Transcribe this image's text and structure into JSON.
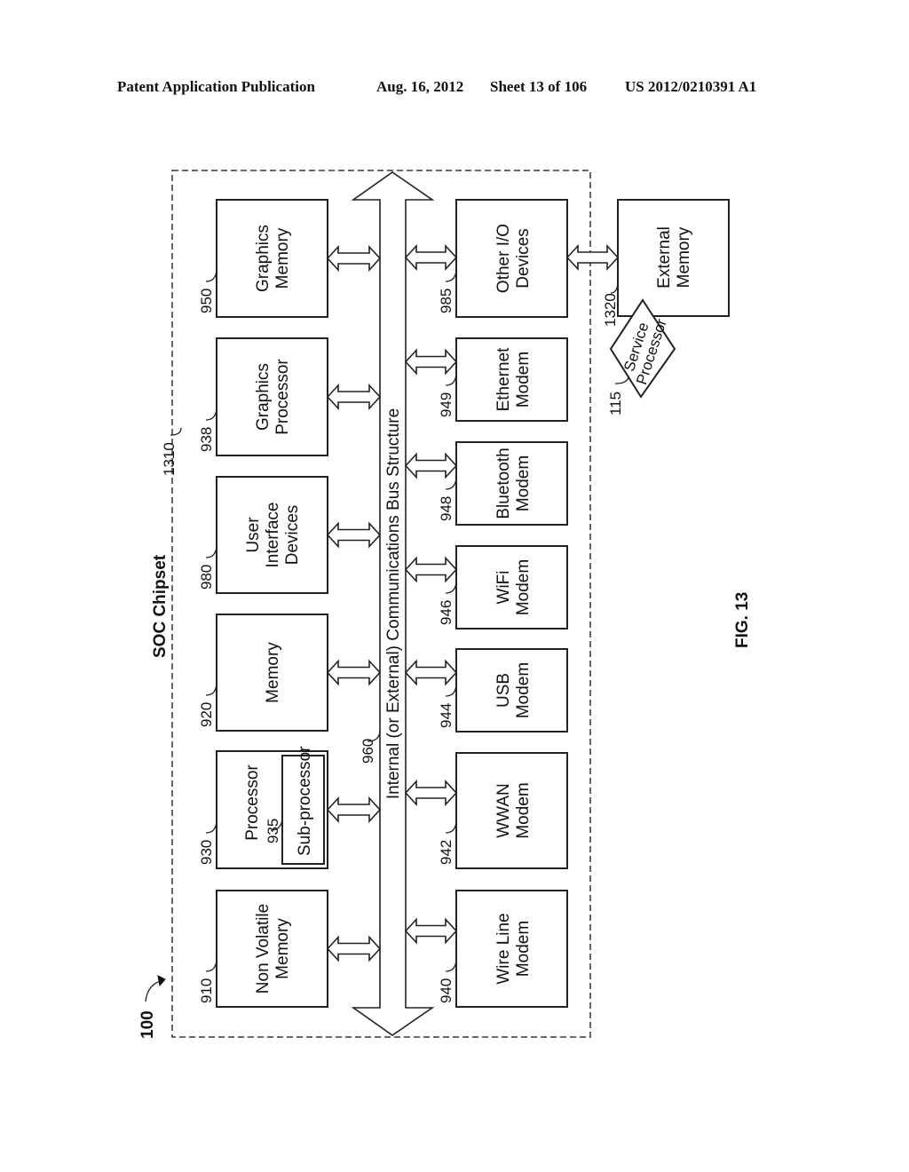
{
  "header": {
    "publication": "Patent Application Publication",
    "date": "Aug. 16, 2012",
    "sheet": "Sheet 13 of 106",
    "number": "US 2012/0210391 A1"
  },
  "figure": {
    "label": "FIG. 13",
    "system_ref": "100",
    "chipset": {
      "title": "SOC Chipset",
      "ref": "1310"
    },
    "bus": {
      "label": "Internal (or External) Communications Bus Structure",
      "ref": "960"
    },
    "left_column": [
      {
        "ref": "950",
        "lines": [
          "Graphics",
          "Memory"
        ]
      },
      {
        "ref": "938",
        "lines": [
          "Graphics",
          "Processor"
        ]
      },
      {
        "ref": "980",
        "lines": [
          "User",
          "Interface",
          "Devices"
        ]
      },
      {
        "ref": "920",
        "lines": [
          "Memory"
        ]
      },
      {
        "ref": "930",
        "lines": [
          "Processor"
        ],
        "sub": {
          "ref": "935",
          "label": "Sub-processor"
        }
      },
      {
        "ref": "910",
        "lines": [
          "Non Volatile",
          "Memory"
        ]
      }
    ],
    "right_column": [
      {
        "ref": "985",
        "lines": [
          "Other I/O",
          "Devices"
        ]
      },
      {
        "ref": "949",
        "lines": [
          "Ethernet",
          "Modem"
        ]
      },
      {
        "ref": "948",
        "lines": [
          "Bluetooth",
          "Modem"
        ]
      },
      {
        "ref": "946",
        "lines": [
          "WiFi",
          "Modem"
        ]
      },
      {
        "ref": "944",
        "lines": [
          "USB",
          "Modem"
        ]
      },
      {
        "ref": "942",
        "lines": [
          "WWAN",
          "Modem"
        ]
      },
      {
        "ref": "940",
        "lines": [
          "Wire Line",
          "Modem"
        ]
      }
    ],
    "external_memory": {
      "ref": "1320",
      "lines": [
        "External",
        "Memory"
      ]
    },
    "service_processor": {
      "ref": "115",
      "lines": [
        "Service",
        "Processor"
      ]
    }
  }
}
